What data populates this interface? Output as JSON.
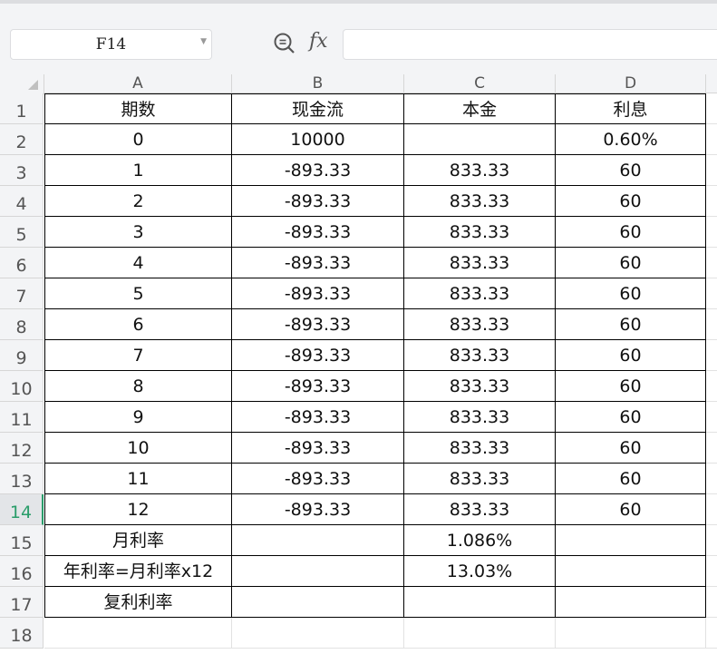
{
  "toolbar": {
    "name_box": "F14",
    "fx_label": "fx",
    "formula": ""
  },
  "columns": [
    "A",
    "B",
    "C",
    "D"
  ],
  "rows": [
    {
      "n": "1",
      "cells": [
        "期数",
        "现金流",
        "本金",
        "利息"
      ]
    },
    {
      "n": "2",
      "cells": [
        "0",
        "10000",
        "",
        "0.60%"
      ]
    },
    {
      "n": "3",
      "cells": [
        "1",
        "-893.33",
        "833.33",
        "60"
      ]
    },
    {
      "n": "4",
      "cells": [
        "2",
        "-893.33",
        "833.33",
        "60"
      ]
    },
    {
      "n": "5",
      "cells": [
        "3",
        "-893.33",
        "833.33",
        "60"
      ]
    },
    {
      "n": "6",
      "cells": [
        "4",
        "-893.33",
        "833.33",
        "60"
      ]
    },
    {
      "n": "7",
      "cells": [
        "5",
        "-893.33",
        "833.33",
        "60"
      ]
    },
    {
      "n": "8",
      "cells": [
        "6",
        "-893.33",
        "833.33",
        "60"
      ]
    },
    {
      "n": "9",
      "cells": [
        "7",
        "-893.33",
        "833.33",
        "60"
      ]
    },
    {
      "n": "10",
      "cells": [
        "8",
        "-893.33",
        "833.33",
        "60"
      ]
    },
    {
      "n": "11",
      "cells": [
        "9",
        "-893.33",
        "833.33",
        "60"
      ]
    },
    {
      "n": "12",
      "cells": [
        "10",
        "-893.33",
        "833.33",
        "60"
      ]
    },
    {
      "n": "13",
      "cells": [
        "11",
        "-893.33",
        "833.33",
        "60"
      ]
    },
    {
      "n": "14",
      "cells": [
        "12",
        "-893.33",
        "833.33",
        "60"
      ]
    },
    {
      "n": "15",
      "cells": [
        "月利率",
        "",
        "1.086%",
        ""
      ]
    },
    {
      "n": "16",
      "cells": [
        "年利率=月利率x12",
        "",
        "13.03%",
        ""
      ]
    },
    {
      "n": "17",
      "cells": [
        "复利利率",
        "",
        "",
        ""
      ]
    },
    {
      "n": "18",
      "cells": [
        "",
        "",
        "",
        ""
      ]
    }
  ],
  "selected_row": "14"
}
